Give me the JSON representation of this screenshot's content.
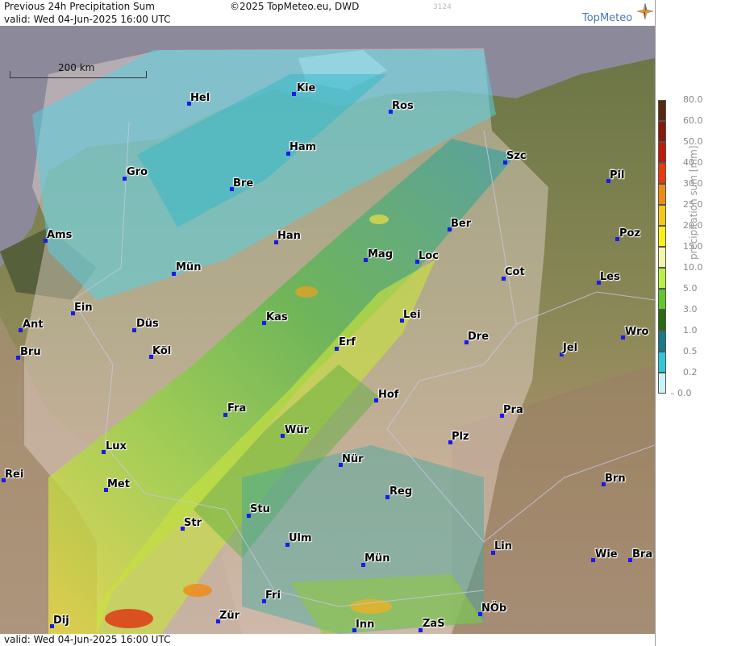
{
  "header": {
    "title": "Previous 24h Precipitation Sum",
    "copyright": "©2025 TopMeteo.eu, DWD",
    "code": "3124",
    "valid": "valid:  Wed  04-Jun-2025 16:00 UTC",
    "logo": "TopMeteo"
  },
  "footer": {
    "valid": "valid:  Wed  04-Jun-2025 16:00 UTC"
  },
  "scale": {
    "label": "200 km"
  },
  "colors": {
    "sea": "#8c8a9a",
    "lowland": "#6e7a46",
    "upland": "#b08a6a",
    "accent": "#1a1aee"
  },
  "legend": {
    "title": "precipitation sum [mm]",
    "ticks": [
      "80.0",
      "60.0",
      "50.0",
      "40.0",
      "30.0",
      "25.0",
      "20.0",
      "15.0",
      "10.0",
      "5.0",
      "3.0",
      "1.0",
      "0.5",
      "0.2",
      "0.0"
    ],
    "colors": [
      "#5a2a10",
      "#8a1a0a",
      "#c01a08",
      "#e83a0a",
      "#f08a12",
      "#f5c818",
      "#f8f018",
      "#f0f8a8",
      "#b8f048",
      "#60c828",
      "#2a6a10",
      "#1a7a8a",
      "#30c8d8",
      "#c8f4f8"
    ]
  },
  "cities": [
    {
      "name": "Hel"
    },
    {
      "name": "Kie"
    },
    {
      "name": "Ros"
    },
    {
      "name": "Ham"
    },
    {
      "name": "Gro"
    },
    {
      "name": "Bre"
    },
    {
      "name": "Szc"
    },
    {
      "name": "Pil"
    },
    {
      "name": "Ber"
    },
    {
      "name": "Ams"
    },
    {
      "name": "Han"
    },
    {
      "name": "Mag"
    },
    {
      "name": "Loc"
    },
    {
      "name": "Poz"
    },
    {
      "name": "Mün"
    },
    {
      "name": "Cot"
    },
    {
      "name": "Les"
    },
    {
      "name": "Ein"
    },
    {
      "name": "Kas"
    },
    {
      "name": "Lei"
    },
    {
      "name": "Ant"
    },
    {
      "name": "Düs"
    },
    {
      "name": "Wro"
    },
    {
      "name": "Bru"
    },
    {
      "name": "Köl"
    },
    {
      "name": "Erf"
    },
    {
      "name": "Dre"
    },
    {
      "name": "Jel"
    },
    {
      "name": "Hof"
    },
    {
      "name": "Fra"
    },
    {
      "name": "Pra"
    },
    {
      "name": "Wür"
    },
    {
      "name": "Plz"
    },
    {
      "name": "Lux"
    },
    {
      "name": "Nür"
    },
    {
      "name": "Rei"
    },
    {
      "name": "Met"
    },
    {
      "name": "Brn"
    },
    {
      "name": "Reg"
    },
    {
      "name": "Stu"
    },
    {
      "name": "Str"
    },
    {
      "name": "Ulm"
    },
    {
      "name": "Lin"
    },
    {
      "name": "Mün"
    },
    {
      "name": "Wie"
    },
    {
      "name": "Bra"
    },
    {
      "name": "Fri"
    },
    {
      "name": "NÖb"
    },
    {
      "name": "Dij"
    },
    {
      "name": "Zür"
    },
    {
      "name": "Inn"
    },
    {
      "name": "ZaS"
    }
  ]
}
